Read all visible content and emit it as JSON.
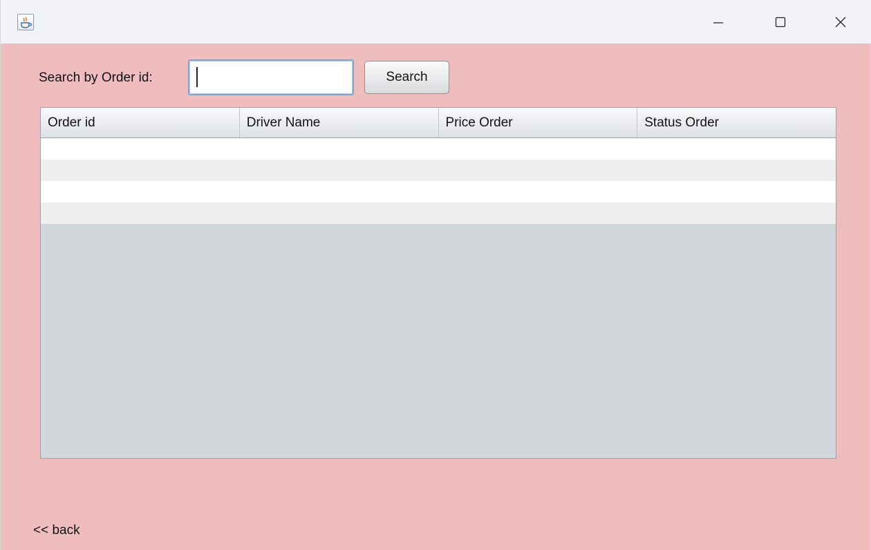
{
  "window": {
    "title": "",
    "icon": "java-icon",
    "controls": [
      "minimize-icon",
      "maximize-icon",
      "close-icon"
    ]
  },
  "search": {
    "label": "Search by Order id:",
    "value": "",
    "placeholder": "",
    "button_label": "Search"
  },
  "table": {
    "columns": [
      "Order id",
      "Driver Name",
      "Price Order",
      "Status Order"
    ],
    "rows": [
      [
        "",
        "",
        "",
        ""
      ],
      [
        "",
        "",
        "",
        ""
      ],
      [
        "",
        "",
        "",
        ""
      ],
      [
        "",
        "",
        "",
        ""
      ]
    ]
  },
  "footer": {
    "back_label": "<< back"
  },
  "colors": {
    "background": "#f0bdbe",
    "titlebar": "#f2f3f6",
    "table_empty_area": "#d1d6da",
    "row_alt": "#efefef"
  }
}
